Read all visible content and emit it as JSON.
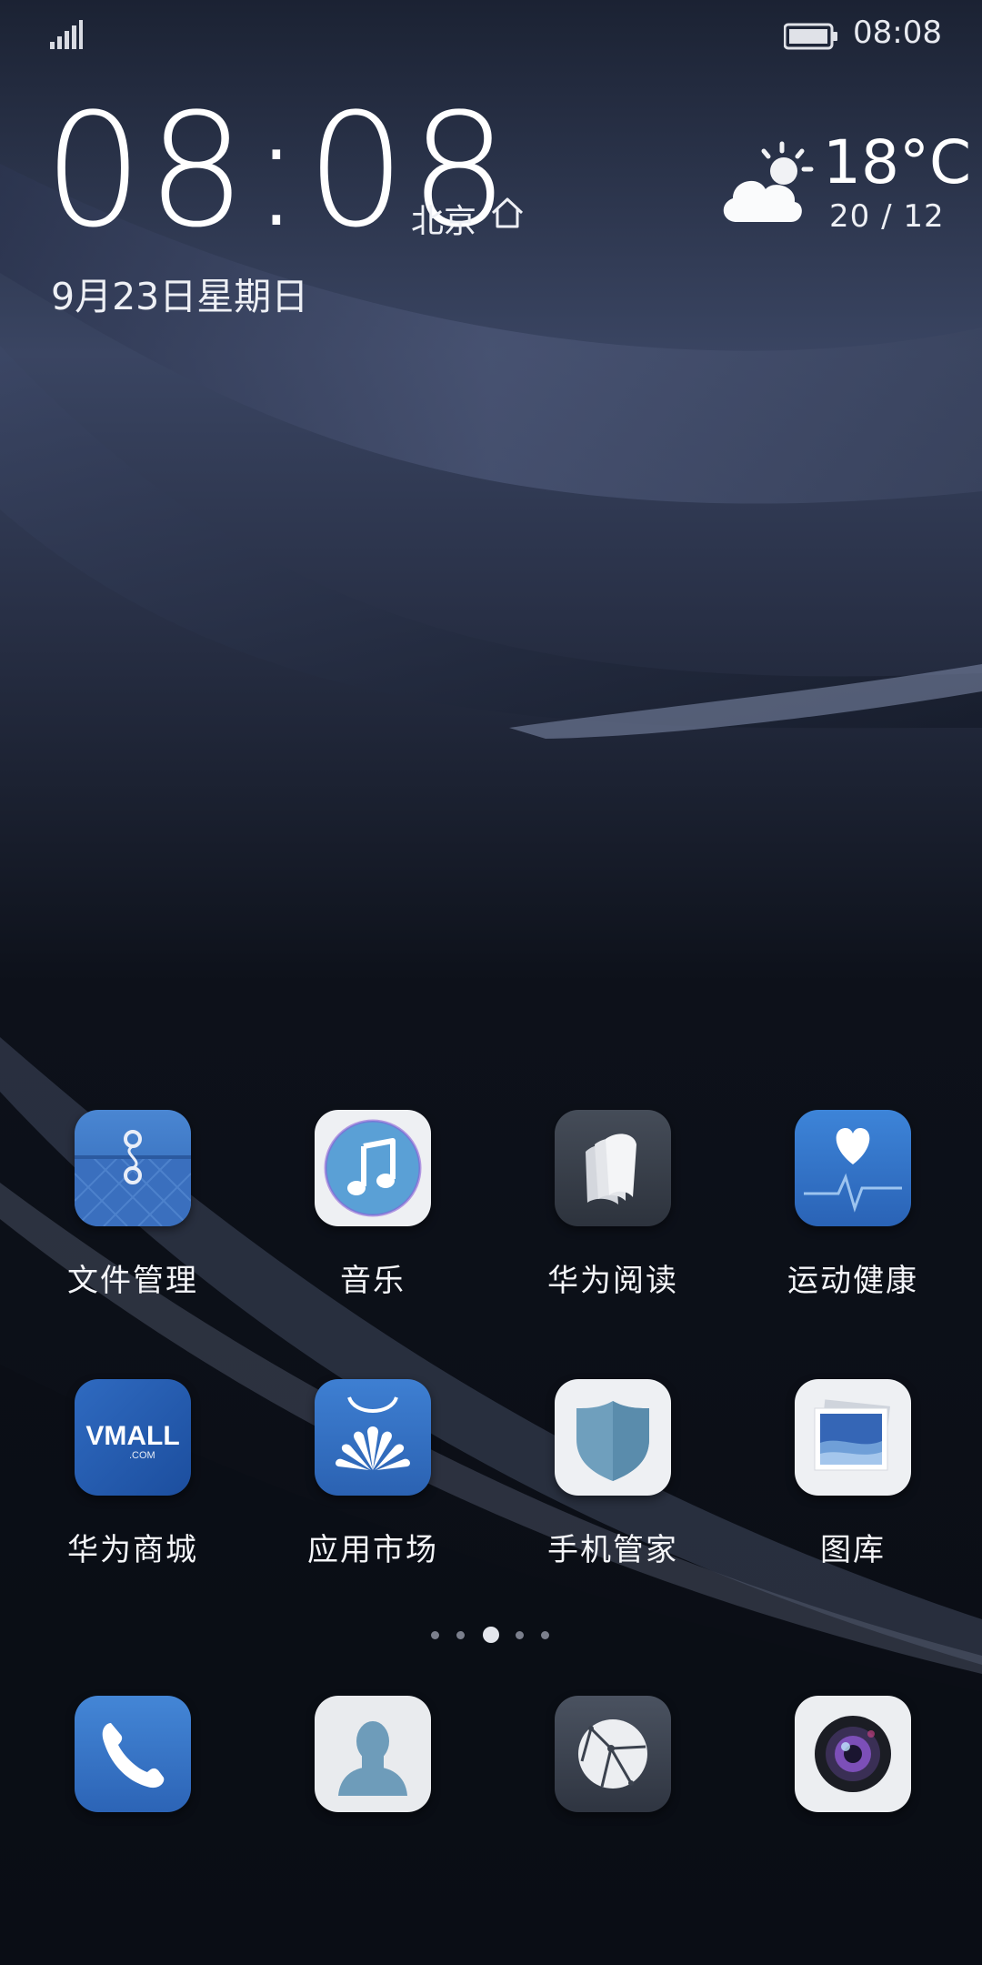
{
  "status_bar": {
    "time": "08:08"
  },
  "clock": {
    "time": "08:08",
    "city": "北京",
    "date": "9月23日星期日"
  },
  "weather": {
    "temperature": "18°C",
    "high_low": "20 / 12",
    "icon": "partly-cloudy-icon"
  },
  "apps_row1": [
    {
      "label": "文件管理",
      "icon": "file-manager-icon"
    },
    {
      "label": "音乐",
      "icon": "music-icon"
    },
    {
      "label": "华为阅读",
      "icon": "reader-icon"
    },
    {
      "label": "运动健康",
      "icon": "health-icon"
    }
  ],
  "apps_row2": [
    {
      "label": "华为商城",
      "icon": "vmall-icon",
      "logo_text": "VMALL",
      "logo_sub": ".COM"
    },
    {
      "label": "应用市场",
      "icon": "app-market-icon"
    },
    {
      "label": "手机管家",
      "icon": "phone-manager-icon"
    },
    {
      "label": "图库",
      "icon": "gallery-icon"
    }
  ],
  "page_indicator": {
    "count": 5,
    "active_index": 2
  },
  "dock": [
    {
      "icon": "phone-icon"
    },
    {
      "icon": "contacts-icon"
    },
    {
      "icon": "browser-icon"
    },
    {
      "icon": "camera-icon"
    }
  ],
  "colors": {
    "blue_tile": "#3a74c4",
    "white_tile": "#eef0f3",
    "dark_tile": "#3c4350"
  }
}
